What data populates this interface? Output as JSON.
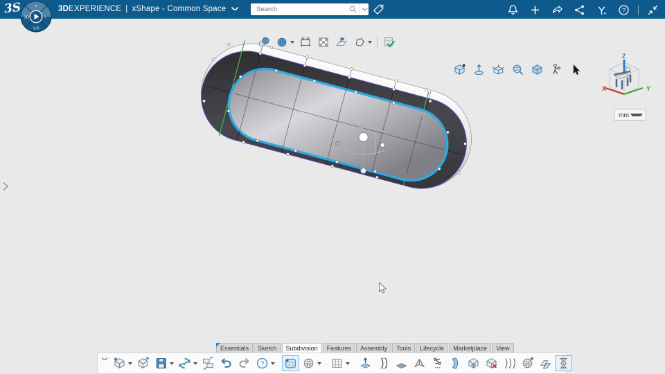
{
  "colors": {
    "topbar": "#0e5a8c",
    "accent_blue": "#2fa9e3",
    "edge_purple": "#4e47a0",
    "edge_green": "#3fae4e",
    "axis_x": "#cc2a2a",
    "axis_y": "#3aa832",
    "axis_z": "#2a7fd4",
    "ok_green": "#2ea44f"
  },
  "topbar": {
    "logo": "3S",
    "title_bold": "3D",
    "title_rest": "EXPERIENCE",
    "title_divider": "|",
    "workspace": "xShape - Common Space",
    "search": {
      "placeholder": "Search",
      "value": ""
    },
    "right_icons": [
      {
        "name": "notifications",
        "icon": "bell"
      },
      {
        "name": "add-content",
        "icon": "plusw"
      },
      {
        "name": "share",
        "icon": "sharew"
      },
      {
        "name": "network",
        "icon": "network"
      },
      {
        "name": "swym",
        "icon": "swym"
      },
      {
        "name": "help",
        "icon": "helpw"
      },
      {
        "sep": true
      },
      {
        "name": "collapse-window",
        "icon": "collapsew"
      }
    ]
  },
  "compass": {
    "north": "ʏ",
    "west": "3D",
    "east": "iˈ",
    "south": "V,R"
  },
  "context_toolbar": {
    "items": [
      {
        "name": "display-control-points",
        "icon": "displaypts"
      },
      {
        "name": "display-mode",
        "icon": "dispmode",
        "dropdown": true
      },
      {
        "name": "box-select",
        "icon": "selbox"
      },
      {
        "name": "pattern-select",
        "icon": "pattern"
      },
      {
        "name": "hide-show-plane",
        "icon": "planeflag"
      },
      {
        "name": "polygon-select",
        "icon": "polygon",
        "dropdown": true
      },
      {
        "sep": true
      },
      {
        "name": "ok-validate",
        "icon": "okcheck"
      }
    ]
  },
  "view_toolbar": {
    "items": [
      {
        "name": "center-tree",
        "icon": "centertree"
      },
      {
        "name": "look-at",
        "icon": "lookat"
      },
      {
        "name": "multi-view",
        "icon": "multiview"
      },
      {
        "name": "zoom-area",
        "icon": "zoomarea"
      },
      {
        "name": "normal-view",
        "icon": "normalview"
      },
      {
        "name": "fly-walk",
        "icon": "flywalk"
      },
      {
        "name": "select-cursor",
        "icon": "cursorb"
      }
    ]
  },
  "triad": {
    "x": "X",
    "y": "Y",
    "z": "Z"
  },
  "units": {
    "value": "mm"
  },
  "tabs": {
    "items": [
      {
        "label": "Essentials",
        "active": false,
        "flag": true
      },
      {
        "label": "Sketch",
        "active": false
      },
      {
        "label": "Subdivision",
        "active": true
      },
      {
        "label": "Features",
        "active": false
      },
      {
        "label": "Assembly",
        "active": false
      },
      {
        "label": "Tools",
        "active": false
      },
      {
        "label": "Lifecycle",
        "active": false
      },
      {
        "label": "Marketplace",
        "active": false
      },
      {
        "label": "View",
        "active": false
      }
    ]
  },
  "dock": {
    "groups": [
      {
        "items": [
          {
            "name": "new-content",
            "icon": "newcontent",
            "dropdown": true
          },
          {
            "name": "open",
            "icon": "open"
          },
          {
            "name": "save",
            "icon": "save",
            "dropdown": true
          },
          {
            "name": "update",
            "icon": "update",
            "dropdown": true
          },
          {
            "name": "swap-window",
            "icon": "swap"
          },
          {
            "name": "undo",
            "icon": "undo"
          },
          {
            "name": "redo",
            "icon": "redo"
          },
          {
            "name": "help",
            "icon": "helpb",
            "dropdown": true
          }
        ]
      },
      {
        "items": [
          {
            "name": "modification",
            "icon": "modification",
            "active": true
          },
          {
            "name": "primitives",
            "icon": "primitives",
            "dropdown": true
          }
        ]
      },
      {
        "items": [
          {
            "name": "construction-grid",
            "icon": "gridp",
            "dropdown": true
          }
        ]
      },
      {
        "items": [
          {
            "name": "extrude-face",
            "icon": "extrude"
          },
          {
            "name": "bend-surface",
            "icon": "bend"
          },
          {
            "name": "inset-face",
            "icon": "inset"
          },
          {
            "name": "sharp-crease",
            "icon": "crease"
          },
          {
            "name": "match-edges",
            "icon": "match"
          },
          {
            "name": "thicken-surface",
            "icon": "thicken"
          },
          {
            "name": "fillet-edge",
            "icon": "fillet"
          },
          {
            "name": "remove-face",
            "icon": "removeface"
          },
          {
            "name": "sweep-surface",
            "icon": "sweep"
          },
          {
            "name": "deform-sphere",
            "icon": "deform"
          },
          {
            "name": "offset-surface",
            "icon": "offsets"
          },
          {
            "name": "symmetry",
            "icon": "symmetry",
            "active": true
          }
        ]
      }
    ]
  }
}
